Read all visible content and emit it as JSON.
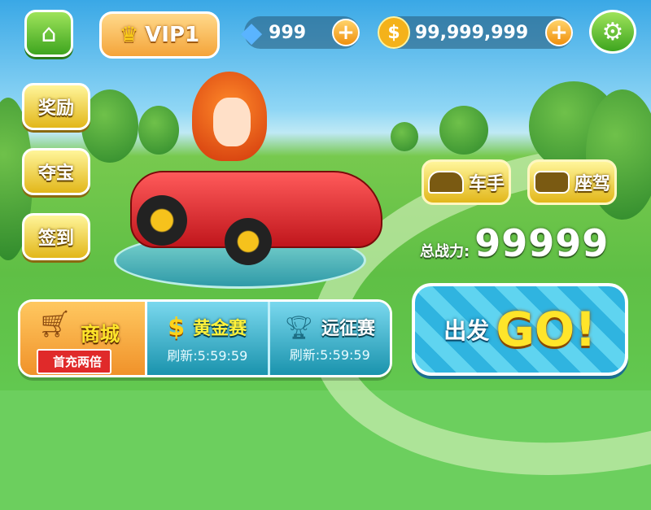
{
  "top": {
    "home_icon": "home-icon",
    "vip_label": "VIP1",
    "gems": "999",
    "coins": "99,999,999",
    "plus": "+",
    "settings_icon": "gear-icon"
  },
  "side": {
    "reward": "奖励",
    "treasure": "夺宝",
    "signin": "签到"
  },
  "pills": {
    "driver": "车手",
    "kart": "座驾"
  },
  "power": {
    "label": "总战力:",
    "value": "99999"
  },
  "bottom": {
    "shop": "商城",
    "shop_tag": "首充两倍",
    "gold": {
      "title": "黄金赛",
      "refresh": "刷新:5:59:59"
    },
    "expedition": {
      "title": "远征赛",
      "refresh": "刷新:5:59:59"
    }
  },
  "go": {
    "prefix": "出发",
    "big": "GO!"
  }
}
